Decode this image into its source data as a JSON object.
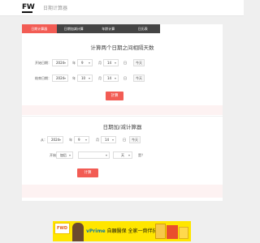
{
  "header": {
    "logo": "FW",
    "site_name": "日期计算器"
  },
  "tabs": [
    "日期计算器",
    "日期加减计算",
    "年龄计算",
    "日历表"
  ],
  "diff_section": {
    "title": "计算两个日期之间相隔天数",
    "start": {
      "label": "开始日期：",
      "year": "2024",
      "month": "9",
      "day": "14",
      "year_unit": "年",
      "month_unit": "月",
      "day_unit": "日",
      "today_button": "今天"
    },
    "end": {
      "label": "结束日期：",
      "year": "2024",
      "month": "10",
      "day": "14",
      "year_unit": "年",
      "month_unit": "月",
      "day_unit": "日",
      "today_button": "今天"
    },
    "submit": "計算"
  },
  "addsub_section": {
    "title": "日期加/减计算器",
    "date": {
      "label": "从：",
      "year": "2024",
      "month": "9",
      "day": "14",
      "year_unit": "年",
      "month_unit": "月",
      "day_unit": "日",
      "today_button": "今天"
    },
    "op": {
      "label": "开始",
      "mode": "加后",
      "amount": "",
      "unit": "天",
      "suffix": "是？"
    },
    "submit": "计算"
  },
  "ad": {
    "brand": "FWD",
    "text_brand": "vPrime",
    "text_main": " 自願醫保 全家一齊伴抗贫?"
  }
}
